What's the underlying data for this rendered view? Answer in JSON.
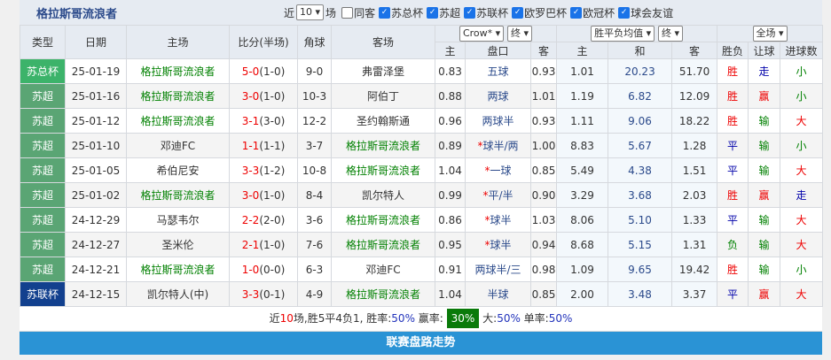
{
  "header": {
    "title": "格拉斯哥流浪者",
    "near_label": "近",
    "count": "10",
    "count_unit": "场",
    "filters": [
      {
        "label": "同客",
        "checked": false
      },
      {
        "label": "苏总杯",
        "checked": true
      },
      {
        "label": "苏超",
        "checked": true
      },
      {
        "label": "苏联杯",
        "checked": true
      },
      {
        "label": "欧罗巴杯",
        "checked": true
      },
      {
        "label": "欧冠杯",
        "checked": true
      },
      {
        "label": "球会友谊",
        "checked": true
      }
    ]
  },
  "selects": {
    "company": "Crow*",
    "asian_time": "终",
    "euro_type": "胜平负均值",
    "euro_time": "终",
    "scope": "全场"
  },
  "columns": {
    "type": "类型",
    "date": "日期",
    "home": "主场",
    "score": "比分(半场)",
    "corner": "角球",
    "away": "客场",
    "a_home": "主",
    "a_line": "盘口",
    "a_away": "客",
    "e_home": "主",
    "e_draw": "和",
    "e_away": "客",
    "result": "胜负",
    "handicap": "让球",
    "goals": "进球数"
  },
  "colors": {
    "苏总杯": "#3cb36a",
    "苏超": "#5aa574",
    "苏联杯": "#12408e"
  },
  "rows": [
    {
      "type": "苏总杯",
      "date": "25-01-19",
      "home": "格拉斯哥流浪者",
      "ft": "5-0",
      "ht": "(1-0)",
      "corner": "9-0",
      "away": "弗雷泽堡",
      "ah": "0.83",
      "line": "五球",
      "star": "",
      "aa": "0.93",
      "eh": "1.01",
      "ed": "20.23",
      "ea": "51.70",
      "res": "胜",
      "hcp": "走",
      "goals": "小"
    },
    {
      "type": "苏超",
      "date": "25-01-16",
      "home": "格拉斯哥流浪者",
      "ft": "3-0",
      "ht": "(1-0)",
      "corner": "10-3",
      "away": "阿伯丁",
      "ah": "0.88",
      "line": "两球",
      "star": "",
      "aa": "1.01",
      "eh": "1.19",
      "ed": "6.82",
      "ea": "12.09",
      "res": "胜",
      "hcp": "赢",
      "goals": "小"
    },
    {
      "type": "苏超",
      "date": "25-01-12",
      "home": "格拉斯哥流浪者",
      "ft": "3-1",
      "ht": "(3-0)",
      "corner": "12-2",
      "away": "圣约翰斯通",
      "ah": "0.96",
      "line": "两球半",
      "star": "",
      "aa": "0.93",
      "eh": "1.11",
      "ed": "9.06",
      "ea": "18.22",
      "res": "胜",
      "hcp": "输",
      "goals": "大"
    },
    {
      "type": "苏超",
      "date": "25-01-10",
      "home": "邓迪FC",
      "ft": "1-1",
      "ht": "(1-1)",
      "corner": "3-7",
      "away": "格拉斯哥流浪者",
      "ah": "0.89",
      "line": "球半/两",
      "star": "*",
      "aa": "1.00",
      "eh": "8.83",
      "ed": "5.67",
      "ea": "1.28",
      "res": "平",
      "hcp": "输",
      "goals": "小"
    },
    {
      "type": "苏超",
      "date": "25-01-05",
      "home": "希伯尼安",
      "ft": "3-3",
      "ht": "(1-2)",
      "corner": "10-8",
      "away": "格拉斯哥流浪者",
      "ah": "1.04",
      "line": "一球",
      "star": "*",
      "aa": "0.85",
      "eh": "5.49",
      "ed": "4.38",
      "ea": "1.51",
      "res": "平",
      "hcp": "输",
      "goals": "大"
    },
    {
      "type": "苏超",
      "date": "25-01-02",
      "home": "格拉斯哥流浪者",
      "ft": "3-0",
      "ht": "(1-0)",
      "corner": "8-4",
      "away": "凯尔特人",
      "ah": "0.99",
      "line": "平/半",
      "star": "*",
      "aa": "0.90",
      "eh": "3.29",
      "ed": "3.68",
      "ea": "2.03",
      "res": "胜",
      "hcp": "赢",
      "goals": "走"
    },
    {
      "type": "苏超",
      "date": "24-12-29",
      "home": "马瑟韦尔",
      "ft": "2-2",
      "ht": "(2-0)",
      "corner": "3-6",
      "away": "格拉斯哥流浪者",
      "ah": "0.86",
      "line": "球半",
      "star": "*",
      "aa": "1.03",
      "eh": "8.06",
      "ed": "5.10",
      "ea": "1.33",
      "res": "平",
      "hcp": "输",
      "goals": "大"
    },
    {
      "type": "苏超",
      "date": "24-12-27",
      "home": "圣米伦",
      "ft": "2-1",
      "ht": "(1-0)",
      "corner": "7-6",
      "away": "格拉斯哥流浪者",
      "ah": "0.95",
      "line": "球半",
      "star": "*",
      "aa": "0.94",
      "eh": "8.68",
      "ed": "5.15",
      "ea": "1.31",
      "res": "负",
      "hcp": "输",
      "goals": "大"
    },
    {
      "type": "苏超",
      "date": "24-12-21",
      "home": "格拉斯哥流浪者",
      "ft": "1-0",
      "ht": "(0-0)",
      "corner": "6-3",
      "away": "邓迪FC",
      "ah": "0.91",
      "line": "两球半/三",
      "star": "",
      "aa": "0.98",
      "eh": "1.09",
      "ed": "9.65",
      "ea": "19.42",
      "res": "胜",
      "hcp": "输",
      "goals": "小"
    },
    {
      "type": "苏联杯",
      "date": "24-12-15",
      "home": "凯尔特人(中)",
      "ft": "3-3",
      "ht": "(0-1)",
      "corner": "4-9",
      "away": "格拉斯哥流浪者",
      "ah": "1.04",
      "line": "半球",
      "star": "",
      "aa": "0.85",
      "eh": "2.00",
      "ed": "3.48",
      "ea": "3.37",
      "res": "平",
      "hcp": "赢",
      "goals": "大"
    }
  ],
  "summary": {
    "pre": "近",
    "n": "10",
    "mid": "场,胜5平4负1, 胜率:",
    "win": "50%",
    "win_l": " 赢率:",
    "ying": "30%",
    "big_l": " 大:",
    "big": "50%",
    "odd_l": " 单率:",
    "odd": "50%"
  },
  "footer": {
    "title": "联赛盘路走势"
  }
}
